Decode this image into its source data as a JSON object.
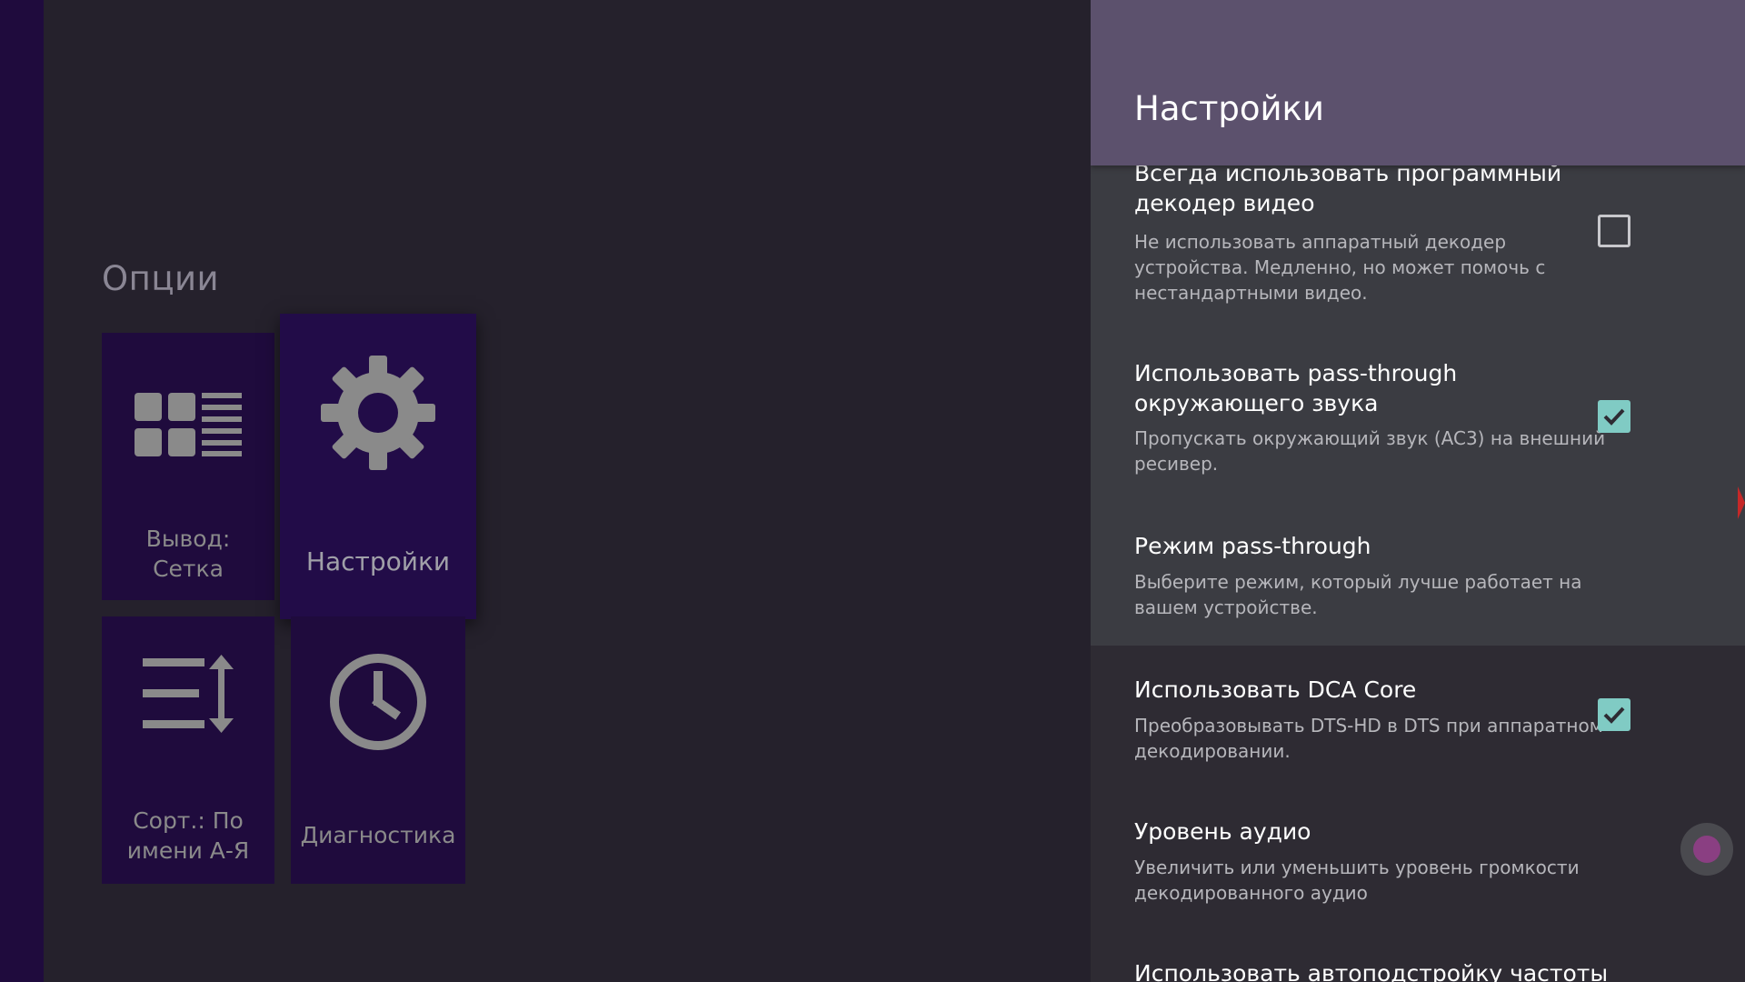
{
  "options": {
    "title": "Опции",
    "tiles": [
      {
        "label": "Вывод:\nСетка",
        "icon": "grid-view-icon"
      },
      {
        "label": "Настройки",
        "icon": "gear-icon"
      },
      {
        "label": "Сорт.: По\nимени А-Я",
        "icon": "sort-icon"
      },
      {
        "label": "Диагностика",
        "icon": "clock-icon"
      }
    ]
  },
  "settings": {
    "title": "Настройки",
    "prefs": [
      {
        "title": "Всегда использовать программный декодер видео",
        "summary": "Не использовать аппаратный декодер устройства. Медленно, но может помочь с нестандартными видео.",
        "checked": false
      },
      {
        "title": "Использовать pass-through окружающего звука",
        "summary": "Пропускать окружающий звук (AC3) на внешний ресивер.",
        "checked": true
      },
      {
        "title": "Режим pass-through",
        "summary": "Выберите режим, который лучше работает на вашем устройстве."
      },
      {
        "title": "Использовать DCA Core",
        "summary": "Преобразовывать DTS-HD в DTS при аппаратном декодировании.",
        "checked": true
      },
      {
        "title": "Уровень аудио",
        "summary": "Увеличить или уменьшить уровень громкости декодированного аудио"
      },
      {
        "title": "Использовать автоподстройку частоты"
      }
    ]
  },
  "colors": {
    "accent_checkbox": "#80cbc4",
    "header": "#5c516d",
    "tile_bg": "#1f0b3d"
  }
}
